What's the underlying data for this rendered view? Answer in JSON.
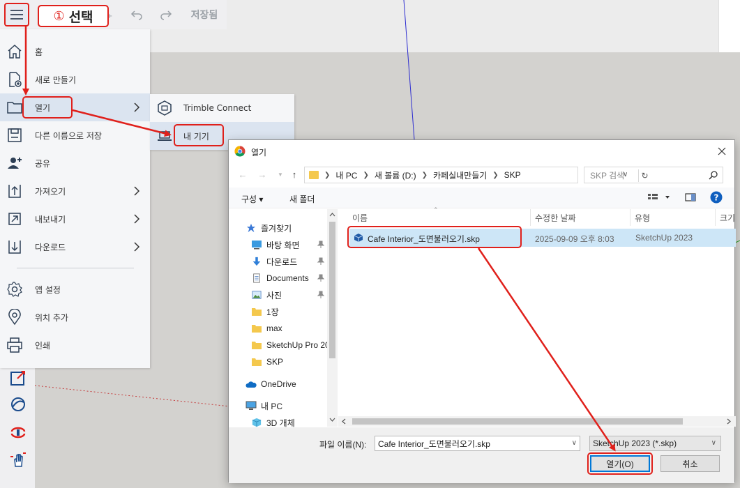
{
  "toolbar": {
    "annotation_select": "선택",
    "annotation_number": "①",
    "saved_status": "저장됨"
  },
  "menu": {
    "items": [
      {
        "label": "홈",
        "icon": "home-icon"
      },
      {
        "label": "새로 만들기",
        "icon": "new-file-icon"
      },
      {
        "label": "열기",
        "icon": "folder-icon"
      },
      {
        "label": "다른 이름으로 저장",
        "icon": "save-icon"
      },
      {
        "label": "공유",
        "icon": "share-user-icon"
      },
      {
        "label": "가져오기",
        "icon": "import-icon"
      },
      {
        "label": "내보내기",
        "icon": "export-icon"
      },
      {
        "label": "다운로드",
        "icon": "download-icon"
      },
      {
        "label": "앱 설정",
        "icon": "gear-icon"
      },
      {
        "label": "위치 추가",
        "icon": "location-pin-icon"
      },
      {
        "label": "인쇄",
        "icon": "printer-icon"
      }
    ]
  },
  "submenu": {
    "items": [
      {
        "label": "Trimble Connect",
        "icon": "trimble-connect-icon"
      },
      {
        "label": "내 기기",
        "icon": "laptop-icon"
      }
    ]
  },
  "dialog": {
    "title": "열기",
    "address": {
      "segments": [
        "내 PC",
        "새 볼륨 (D:)",
        "카페실내만들기",
        "SKP"
      ]
    },
    "search_placeholder": "SKP 검색",
    "commands": {
      "organize": "구성",
      "new_folder": "새 폴더"
    },
    "nav": [
      {
        "label": "즐겨찾기",
        "icon": "star-icon",
        "pinned": false
      },
      {
        "label": "바탕 화면",
        "icon": "desktop-icon",
        "pinned": true
      },
      {
        "label": "다운로드",
        "icon": "download-arrow-icon",
        "pinned": true
      },
      {
        "label": "Documents",
        "icon": "documents-icon",
        "pinned": true
      },
      {
        "label": "사진",
        "icon": "pictures-icon",
        "pinned": true
      },
      {
        "label": "1장",
        "icon": "folder-icon",
        "pinned": false
      },
      {
        "label": "max",
        "icon": "folder-icon",
        "pinned": false
      },
      {
        "label": "SketchUp Pro 20",
        "icon": "folder-icon",
        "pinned": false
      },
      {
        "label": "SKP",
        "icon": "folder-icon",
        "pinned": false
      },
      {
        "label": "OneDrive",
        "icon": "onedrive-icon",
        "pinned": false
      },
      {
        "label": "내 PC",
        "icon": "pc-icon",
        "pinned": false
      },
      {
        "label": "3D 개체",
        "icon": "3d-objects-icon",
        "pinned": false
      }
    ],
    "columns": {
      "name": "이름",
      "modified": "수정한 날짜",
      "type": "유형",
      "size": "크기"
    },
    "files": [
      {
        "name": "Cafe Interior_도면불러오기.skp",
        "modified": "2025-09-09 오후 8:03",
        "type": "SketchUp 2023"
      }
    ],
    "filename_label": "파일 이름(N):",
    "filename_value": "Cafe Interior_도면불러오기.skp",
    "filetype_value": "SketchUp 2023 (*.skp)",
    "open_button": "열기(O)",
    "cancel_button": "취소"
  },
  "colors": {
    "annotation": "#e0201b",
    "selection": "#cde6f7",
    "menu_active": "#dbe4f0",
    "canvas": "#d3d2cf"
  }
}
